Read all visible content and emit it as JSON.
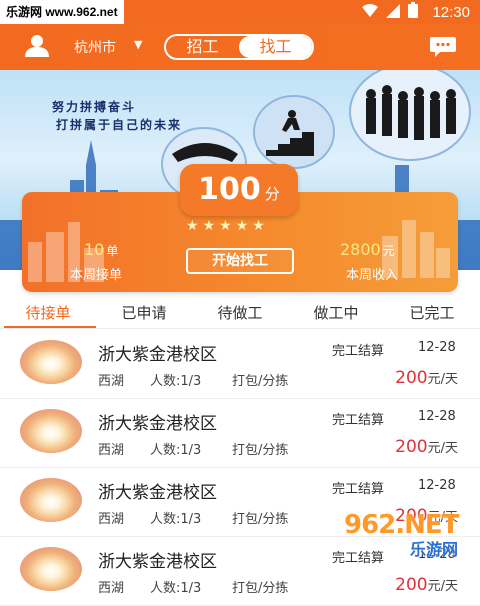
{
  "watermark": {
    "site": "乐游网 www.962.net",
    "logo_num": "962.NET",
    "logo_sub": "乐游网"
  },
  "status_bar": {
    "time": "12:30"
  },
  "app_bar": {
    "city": "杭州市",
    "toggle": [
      {
        "label": "招工",
        "active": false
      },
      {
        "label": "找工",
        "active": true
      }
    ]
  },
  "banner": {
    "slogan_line1": "努力拼搏奋斗",
    "slogan_line2": "打拼属于自己的未来"
  },
  "summary": {
    "score": "100",
    "score_unit": "分",
    "stars": 5,
    "orders_value": "10",
    "orders_unit": "单",
    "orders_label": "本周接单",
    "income_value": "2800",
    "income_unit": "元",
    "income_label": "本周收入",
    "start_button": "开始找工"
  },
  "tabs": [
    {
      "label": "待接单",
      "active": true
    },
    {
      "label": "已申请",
      "active": false
    },
    {
      "label": "待做工",
      "active": false
    },
    {
      "label": "做工中",
      "active": false
    },
    {
      "label": "已完工",
      "active": false
    }
  ],
  "jobs": [
    {
      "title": "浙大紫金港校区",
      "settle": "完工结算",
      "date": "12-28",
      "area": "西湖",
      "count": "人数:1/3",
      "work": "打包/分拣",
      "price": "200",
      "price_unit": "元/天"
    },
    {
      "title": "浙大紫金港校区",
      "settle": "完工结算",
      "date": "12-28",
      "area": "西湖",
      "count": "人数:1/3",
      "work": "打包/分拣",
      "price": "200",
      "price_unit": "元/天"
    },
    {
      "title": "浙大紫金港校区",
      "settle": "完工结算",
      "date": "12-28",
      "area": "西湖",
      "count": "人数:1/3",
      "work": "打包/分拣",
      "price": "200",
      "price_unit": "元/天"
    },
    {
      "title": "浙大紫金港校区",
      "settle": "完工结算",
      "date": "12-28",
      "area": "西湖",
      "count": "人数:1/3",
      "work": "打包/分拣",
      "price": "200",
      "price_unit": "元/天"
    }
  ],
  "colors": {
    "brand": "#f26a1f",
    "price": "#e0323a",
    "star": "#fff2b8"
  }
}
